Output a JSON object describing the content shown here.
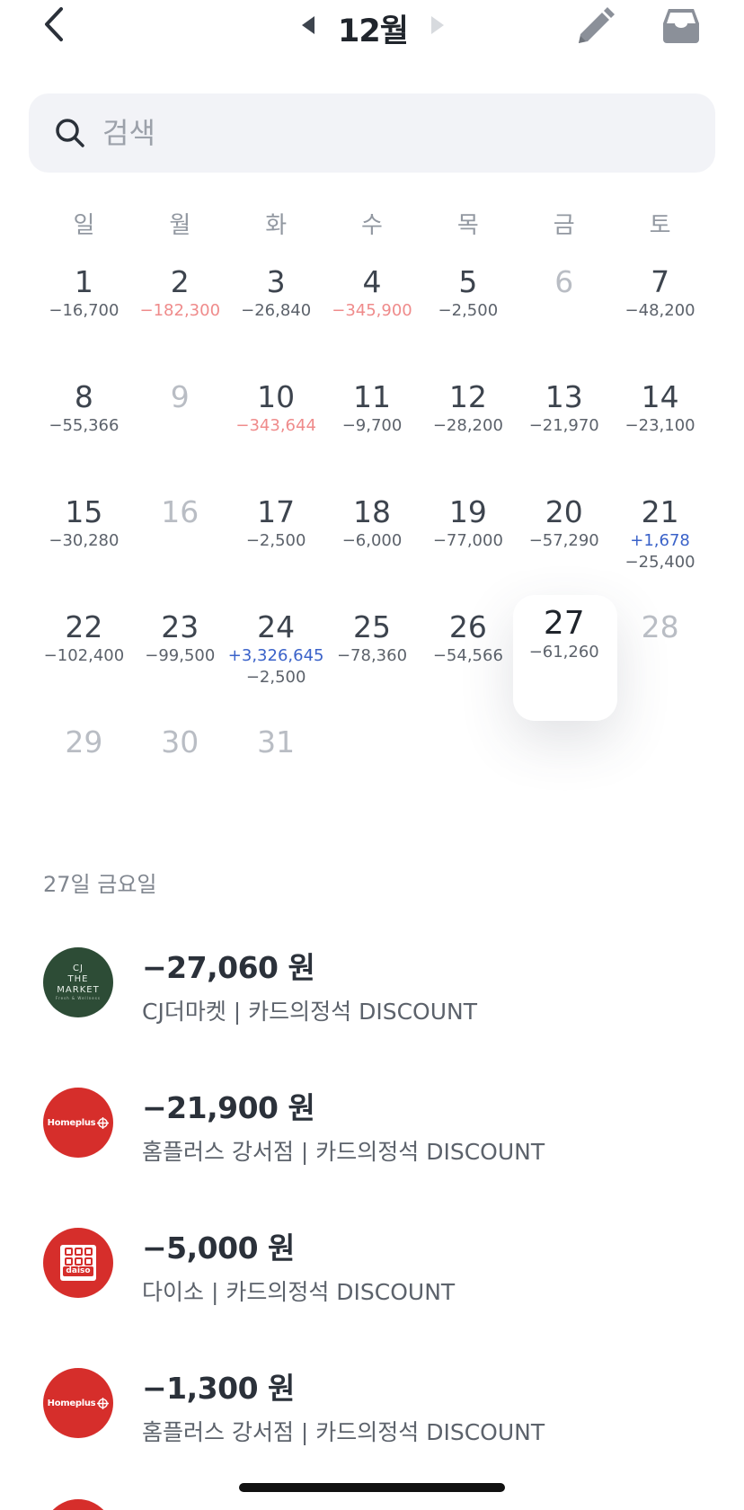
{
  "header": {
    "month_title": "12월"
  },
  "search": {
    "placeholder": "검색",
    "value": ""
  },
  "calendar": {
    "weekdays": [
      "일",
      "월",
      "화",
      "수",
      "목",
      "금",
      "토"
    ],
    "weeks": [
      [
        {
          "day": "1",
          "amounts": [
            {
              "text": "−16,700",
              "kind": "expense"
            }
          ]
        },
        {
          "day": "2",
          "amounts": [
            {
              "text": "−182,300",
              "kind": "big-expense"
            }
          ]
        },
        {
          "day": "3",
          "amounts": [
            {
              "text": "−26,840",
              "kind": "expense"
            }
          ]
        },
        {
          "day": "4",
          "amounts": [
            {
              "text": "−345,900",
              "kind": "big-expense"
            }
          ]
        },
        {
          "day": "5",
          "amounts": [
            {
              "text": "−2,500",
              "kind": "expense"
            }
          ]
        },
        {
          "day": "6",
          "amounts": [],
          "dim": true
        },
        {
          "day": "7",
          "amounts": [
            {
              "text": "−48,200",
              "kind": "expense"
            }
          ]
        }
      ],
      [
        {
          "day": "8",
          "amounts": [
            {
              "text": "−55,366",
              "kind": "expense"
            }
          ]
        },
        {
          "day": "9",
          "amounts": [],
          "dim": true
        },
        {
          "day": "10",
          "amounts": [
            {
              "text": "−343,644",
              "kind": "big-expense"
            }
          ]
        },
        {
          "day": "11",
          "amounts": [
            {
              "text": "−9,700",
              "kind": "expense"
            }
          ]
        },
        {
          "day": "12",
          "amounts": [
            {
              "text": "−28,200",
              "kind": "expense"
            }
          ]
        },
        {
          "day": "13",
          "amounts": [
            {
              "text": "−21,970",
              "kind": "expense"
            }
          ]
        },
        {
          "day": "14",
          "amounts": [
            {
              "text": "−23,100",
              "kind": "expense"
            }
          ]
        }
      ],
      [
        {
          "day": "15",
          "amounts": [
            {
              "text": "−30,280",
              "kind": "expense"
            }
          ]
        },
        {
          "day": "16",
          "amounts": [],
          "dim": true
        },
        {
          "day": "17",
          "amounts": [
            {
              "text": "−2,500",
              "kind": "expense"
            }
          ]
        },
        {
          "day": "18",
          "amounts": [
            {
              "text": "−6,000",
              "kind": "expense"
            }
          ]
        },
        {
          "day": "19",
          "amounts": [
            {
              "text": "−77,000",
              "kind": "expense"
            }
          ]
        },
        {
          "day": "20",
          "amounts": [
            {
              "text": "−57,290",
              "kind": "expense"
            }
          ]
        },
        {
          "day": "21",
          "amounts": [
            {
              "text": "+1,678",
              "kind": "income"
            },
            {
              "text": "−25,400",
              "kind": "expense"
            }
          ]
        }
      ],
      [
        {
          "day": "22",
          "amounts": [
            {
              "text": "−102,400",
              "kind": "expense"
            }
          ]
        },
        {
          "day": "23",
          "amounts": [
            {
              "text": "−99,500",
              "kind": "expense"
            }
          ]
        },
        {
          "day": "24",
          "amounts": [
            {
              "text": "+3,326,645",
              "kind": "income"
            },
            {
              "text": "−2,500",
              "kind": "expense"
            }
          ]
        },
        {
          "day": "25",
          "amounts": [
            {
              "text": "−78,360",
              "kind": "expense"
            }
          ]
        },
        {
          "day": "26",
          "amounts": [
            {
              "text": "−54,566",
              "kind": "expense"
            }
          ]
        },
        {
          "day": "27",
          "amounts": [
            {
              "text": "−61,260",
              "kind": "expense"
            }
          ],
          "selected": true
        },
        {
          "day": "28",
          "amounts": [],
          "dim": true
        }
      ],
      [
        {
          "day": "29",
          "amounts": [],
          "dim": true
        },
        {
          "day": "30",
          "amounts": [],
          "dim": true
        },
        {
          "day": "31",
          "amounts": [],
          "dim": true
        }
      ]
    ]
  },
  "detail": {
    "date_label": "27일 금요일",
    "transactions": [
      {
        "logo": "cj",
        "logo_lines": [
          "CJ",
          "THE",
          "MARKET"
        ],
        "logo_sub": "Fresh & Wellness",
        "amount": "−27,060 원",
        "desc": "CJ더마켓 | 카드의정석 DISCOUNT"
      },
      {
        "logo": "homeplus",
        "logo_text": "Homeplus",
        "amount": "−21,900 원",
        "desc": "홈플러스 강서점 | 카드의정석 DISCOUNT"
      },
      {
        "logo": "daiso",
        "logo_text": "daiso",
        "amount": "−5,000 원",
        "desc": "다이소 | 카드의정석 DISCOUNT"
      },
      {
        "logo": "homeplus",
        "logo_text": "Homeplus",
        "amount": "−1,300 원",
        "desc": "홈플러스 강서점 | 카드의정석 DISCOUNT"
      }
    ]
  },
  "colors": {
    "expense": "#5c626b",
    "big_expense": "#ef8b8b",
    "income": "#3a62c9",
    "dim_day": "#b9bdc4",
    "cj_green": "#2d4c36",
    "brand_red": "#d62e2b"
  },
  "icons": {
    "back": "chevron-left-icon",
    "prev_month": "triangle-left-icon",
    "next_month": "triangle-right-icon",
    "edit": "pencil-icon",
    "inbox": "inbox-tray-icon",
    "search": "magnifier-icon"
  }
}
